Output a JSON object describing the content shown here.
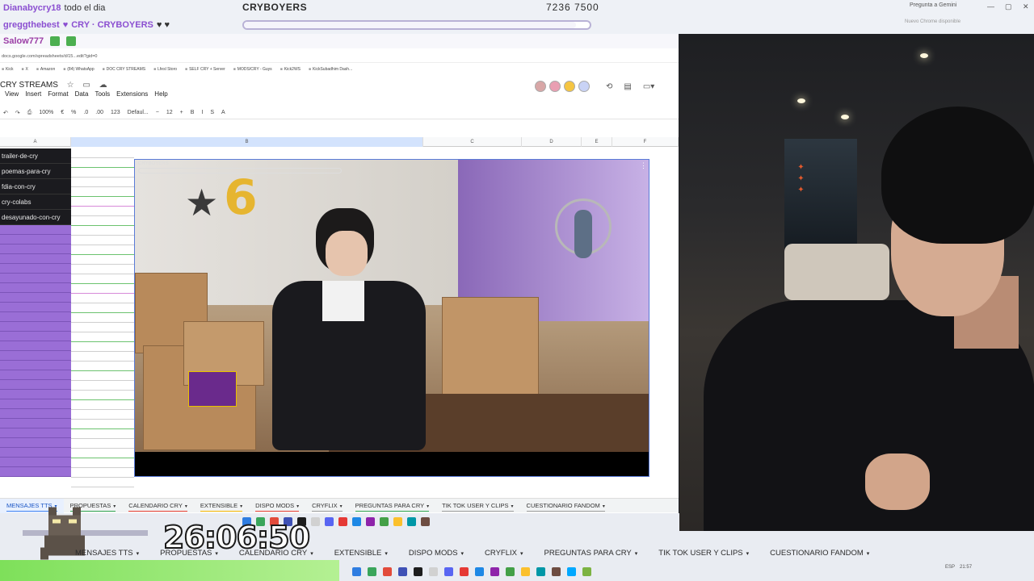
{
  "overlay": {
    "chat1_user": "Dianabycry18",
    "chat1_msg": "todo el dia",
    "stream_title": "CRYBOYERS",
    "counter": "7236  7500",
    "chat2_user": "greggthebest",
    "chat2_msg": "CRY · CRYBOYERS",
    "chat3_user": "Salow777",
    "goal_progress": 0.96
  },
  "browser": {
    "gemini": "Pregunta a Gemini",
    "right_hint": "Nuevo Chrome disponible",
    "url": "docs.google.com/spreadsheets/d/15...edit?gid=0",
    "bookmarks": [
      "Kick",
      "X",
      "Amazon",
      "(84) WhatsApp",
      "DOC CRY STREAMS",
      "Lfesl Storo",
      "SELF CRY + Server",
      "MODS/CRY - Guys",
      "Kick2WS",
      "KickSubadhim Dash..."
    ],
    "doc_title": "CRY STREAMS",
    "menus": [
      "View",
      "Insert",
      "Format",
      "Data",
      "Tools",
      "Extensions",
      "Help"
    ],
    "toolbar": [
      "↶",
      "↷",
      "⎙",
      "100%",
      "€",
      "%",
      ".0",
      ".00",
      "123",
      "Defaul...",
      "−",
      "12",
      "+",
      "B",
      "I",
      "S",
      "A"
    ],
    "columns": [
      "A",
      "B",
      "C",
      "D",
      "E",
      "F"
    ],
    "col_a_cells": [
      "trailer-de-cry",
      "poemas-para-cry",
      "fdia-con-cry",
      "cry-colabs",
      "desayunado-con-cry"
    ],
    "video_overlay_title": "CRYBOYERS",
    "sheet_tabs": [
      {
        "label": "MENSAJES TTS",
        "color": "#4285f4"
      },
      {
        "label": "PROPUESTAS",
        "color": "#34a853"
      },
      {
        "label": "CALENDARIO CRY",
        "color": "#ea4335"
      },
      {
        "label": "EXTENSIBLE",
        "color": "#fbbc04"
      },
      {
        "label": "DISPO MODS",
        "color": "#ea4335"
      },
      {
        "label": "CRYFLIX",
        "color": "#9e9e9e"
      },
      {
        "label": "PREGUNTAS PARA CRY",
        "color": "#34a853"
      },
      {
        "label": "TIK TOK USER Y CLIPS",
        "color": "#9e9e9e"
      },
      {
        "label": "CUESTIONARIO FANDOM",
        "color": "#9e9e9e"
      }
    ]
  },
  "stream_bottom": {
    "timer": "26:06:50",
    "tabs": [
      "MENSAJES TTS",
      "PROPUESTAS",
      "CALENDARIO CRY",
      "EXTENSIBLE",
      "DISPO MODS",
      "CRYFLIX",
      "PREGUNTAS PARA CRY",
      "TIK TOK USER Y CLIPS",
      "CUESTIONARIO FANDOM"
    ],
    "tray_lang": "ESP",
    "tray_time": "21:57"
  },
  "colors": {
    "accent": "#9a6ed6",
    "sheet_blue": "#1a56c5"
  }
}
